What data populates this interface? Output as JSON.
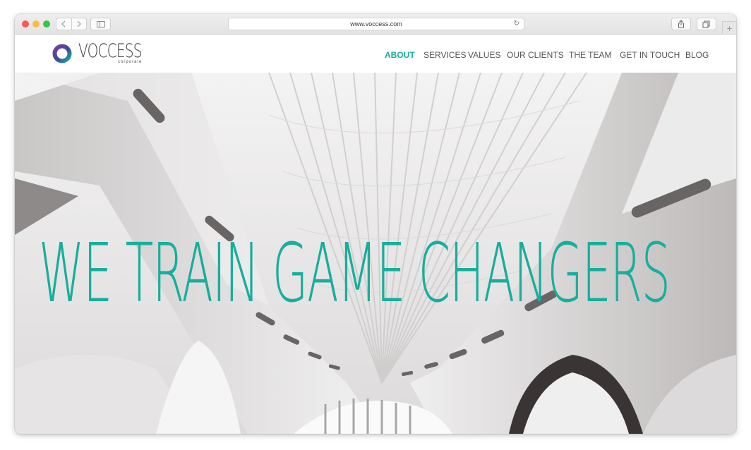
{
  "browser": {
    "url": "www.voccess.com",
    "back_icon": "chevron-left-icon",
    "forward_icon": "chevron-right-icon",
    "reload_icon": "reload-icon",
    "share_icon": "share-icon",
    "tabs_icon": "tabs-icon",
    "new_tab_icon": "plus-icon"
  },
  "brand": {
    "name": "VOCCESS",
    "tagline": "corporate",
    "colors": {
      "accent": "#17ae9c",
      "logo_purple": "#5b3f8f",
      "logo_teal": "#17ae9c"
    }
  },
  "nav": {
    "items": [
      {
        "label": "ABOUT",
        "active": true
      },
      {
        "label": "SERVICES",
        "active": false
      },
      {
        "label": "VALUES",
        "active": false
      },
      {
        "label": "OUR CLIENTS",
        "active": false
      },
      {
        "label": "THE TEAM",
        "active": false
      },
      {
        "label": "GET IN TOUCH",
        "active": false
      },
      {
        "label": "BLOG",
        "active": false
      }
    ]
  },
  "hero": {
    "headline": "WE TRAIN GAME CHANGERS"
  }
}
